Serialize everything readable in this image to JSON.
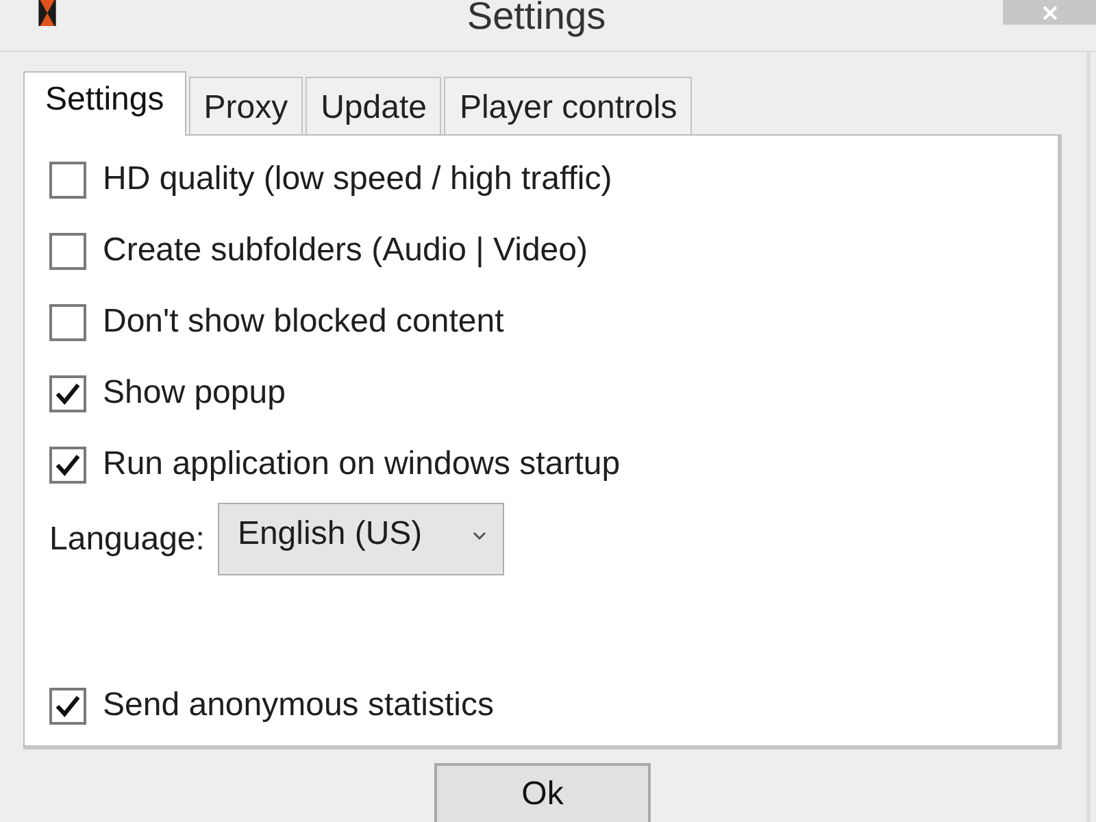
{
  "window": {
    "title": "Settings"
  },
  "tabs": [
    {
      "label": "Settings",
      "selected": true
    },
    {
      "label": "Proxy",
      "selected": false
    },
    {
      "label": "Update",
      "selected": false
    },
    {
      "label": "Player controls",
      "selected": false
    }
  ],
  "options": [
    {
      "label": "HD quality (low speed / high traffic)",
      "checked": false
    },
    {
      "label": "Create subfolders (Audio | Video)",
      "checked": false
    },
    {
      "label": "Don't show blocked content",
      "checked": false
    },
    {
      "label": "Show popup",
      "checked": true
    },
    {
      "label": "Run application on windows startup",
      "checked": true
    }
  ],
  "language": {
    "label": "Language:",
    "value": "English (US)"
  },
  "bottom_options": [
    {
      "label": "Send anonymous statistics",
      "checked": true
    }
  ],
  "buttons": [
    {
      "label": "Ok"
    }
  ]
}
